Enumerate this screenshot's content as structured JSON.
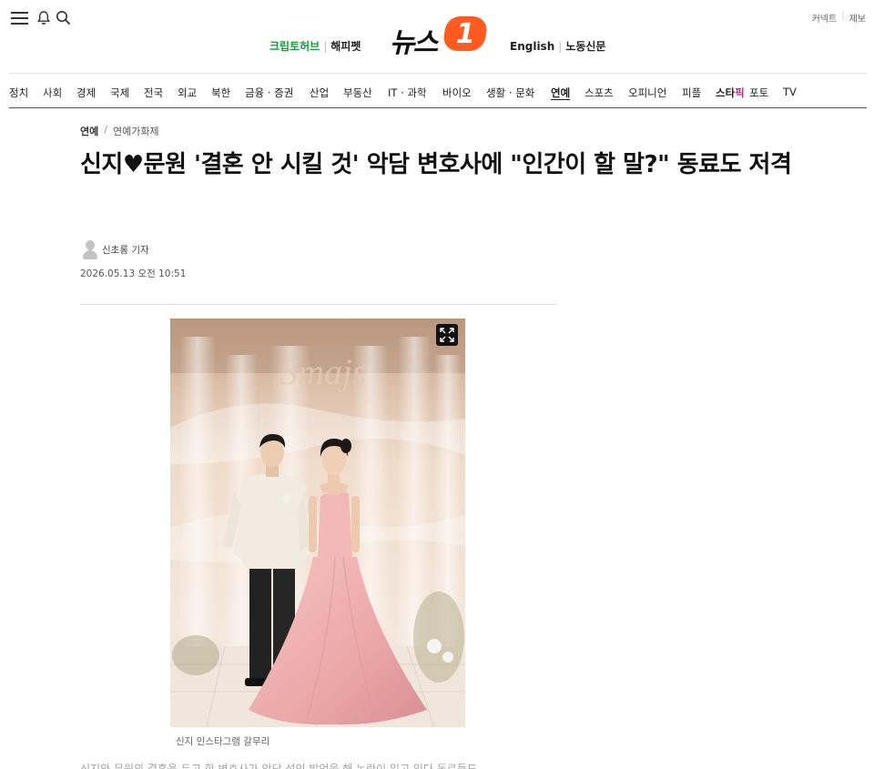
{
  "header": {
    "util_links": [
      "커넥트",
      "제보"
    ],
    "brand_left": {
      "krip": "크립토허브",
      "happy": "해피펫"
    },
    "logo": {
      "text": "뉴스",
      "badge": "1"
    },
    "brand_right": {
      "english": "English",
      "labor": "노동신문"
    }
  },
  "nav": {
    "items": [
      "정치",
      "사회",
      "경제",
      "국제",
      "전국",
      "외교",
      "북한",
      "금융 · 증권",
      "산업",
      "부동산",
      "IT · 과학",
      "바이오",
      "생활 · 문화",
      "연예",
      "스포츠",
      "오피니언",
      "피플",
      "스타",
      "포토",
      "TV"
    ],
    "star_suffix": "픽",
    "active": "연예"
  },
  "article": {
    "breadcrumb": {
      "category": "연예",
      "sub": "연예가화제"
    },
    "title": "신지♥문원 '결혼 안 시킬 것' 악담 변호사에 \"인간이 할 말?\" 동료도 저격",
    "reporter": "신초롱 기자",
    "date": "2026.05.13 오전 10:51",
    "photo_caption": "신지 인스타그램 갈무리",
    "photo_sign": "Smajs",
    "body_preview": "신지와 문원의 결혼을 두고 한 변호사가 악담 섞인 발언을 해 논란이 일고 있다 동료들도"
  },
  "colors": {
    "accent": "#ff5a1f",
    "krip": "#1a9a3a",
    "star": "#e0169e"
  }
}
